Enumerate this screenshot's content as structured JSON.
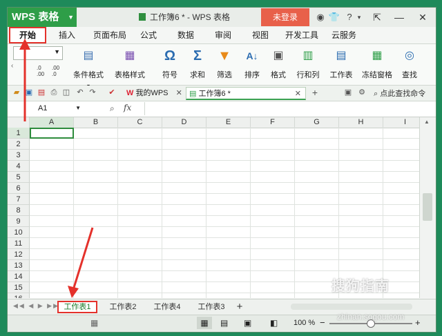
{
  "app": {
    "logo_text": "WPS 表格",
    "doc_title": "工作簿6 * - WPS 表格",
    "login_label": "未登录"
  },
  "menu": {
    "items": [
      "开始",
      "插入",
      "页面布局",
      "公式",
      "数据",
      "审阅",
      "视图",
      "开发工具",
      "云服务"
    ]
  },
  "ribbon": {
    "items": [
      {
        "label": "条件格式",
        "icon": "conditional-format-icon"
      },
      {
        "label": "表格样式",
        "icon": "table-style-icon"
      },
      {
        "label": "符号",
        "icon": "symbol-icon",
        "glyph": "Ω"
      },
      {
        "label": "求和",
        "icon": "sum-icon",
        "glyph": "Σ"
      },
      {
        "label": "筛选",
        "icon": "filter-icon"
      },
      {
        "label": "排序",
        "icon": "sort-icon"
      },
      {
        "label": "格式",
        "icon": "format-icon"
      },
      {
        "label": "行和列",
        "icon": "row-col-icon"
      },
      {
        "label": "工作表",
        "icon": "worksheet-icon"
      },
      {
        "label": "冻结窗格",
        "icon": "freeze-icon"
      },
      {
        "label": "查找",
        "icon": "find-icon"
      }
    ],
    "decimal_up": ".0\n.00",
    "decimal_down": ".00\n.0"
  },
  "doc_tabs": {
    "mywps": "我的WPS",
    "workbook": "工作簿6 *",
    "search_cmd": "点此查找命令"
  },
  "formula_bar": {
    "cell_ref": "A1",
    "fx": "fx"
  },
  "grid": {
    "columns": [
      "A",
      "B",
      "C",
      "D",
      "E",
      "F",
      "G",
      "H",
      "I"
    ],
    "rows": [
      "1",
      "2",
      "3",
      "4",
      "5",
      "6",
      "7",
      "8",
      "9",
      "10",
      "11",
      "12",
      "13",
      "14",
      "15",
      "16"
    ]
  },
  "sheets": {
    "tabs": [
      "工作表1",
      "工作表2",
      "工作表4",
      "工作表3"
    ],
    "add": "+"
  },
  "status": {
    "zoom": "100 %",
    "minus": "−",
    "plus": "+"
  },
  "watermark": {
    "text": "搜狗指南",
    "url": "zhinan.sogou.com"
  },
  "colors": {
    "accent_green": "#2e9e48",
    "login_red": "#e8604a",
    "highlight_red": "#e4312b"
  }
}
